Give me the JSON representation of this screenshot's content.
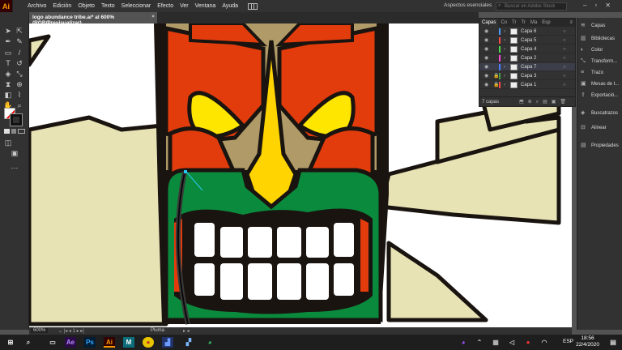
{
  "app": {
    "logo": "Ai",
    "workspace": "Aspectos esenciales",
    "search_placeholder": "Buscar en Adobe Stock"
  },
  "menu": [
    "Archivo",
    "Edición",
    "Objeto",
    "Texto",
    "Seleccionar",
    "Efecto",
    "Ver",
    "Ventana",
    "Ayuda"
  ],
  "document_tab": {
    "title": "logo abundance tribe.ai* al 600% (RGB/Previsualizar)",
    "close": "×"
  },
  "status": {
    "zoom": "600%",
    "tool": "Pluma"
  },
  "layers_panel": {
    "tabs": [
      "Capas",
      "Co",
      "Tr",
      "Tr",
      "Ma",
      "Esp"
    ],
    "rows": [
      {
        "name": "Capa 6",
        "color": "#4f9dff",
        "selected": false
      },
      {
        "name": "Capa 5",
        "color": "#ff4a4a",
        "selected": false
      },
      {
        "name": "Capa 4",
        "color": "#4adb4a",
        "selected": false
      },
      {
        "name": "Capa 2",
        "color": "#ff4ad8",
        "selected": false
      },
      {
        "name": "Capa 7",
        "color": "#4a7dff",
        "selected": true
      },
      {
        "name": "Capa 3",
        "color": "#4a9d4a",
        "selected": false
      },
      {
        "name": "Capa 1",
        "color": "#ff4a4a",
        "selected": false
      }
    ],
    "footer": "7 capas"
  },
  "right_panel": [
    "Capas",
    "Bibliotecas",
    "Color",
    "Transform...",
    "Trazo",
    "Mesas de t...",
    "Exportació...",
    "Buscatrazos",
    "Alinear",
    "Propiedades"
  ],
  "taskbar": {
    "lang": "ESP",
    "time": "18:56",
    "date": "22/4/2020"
  }
}
